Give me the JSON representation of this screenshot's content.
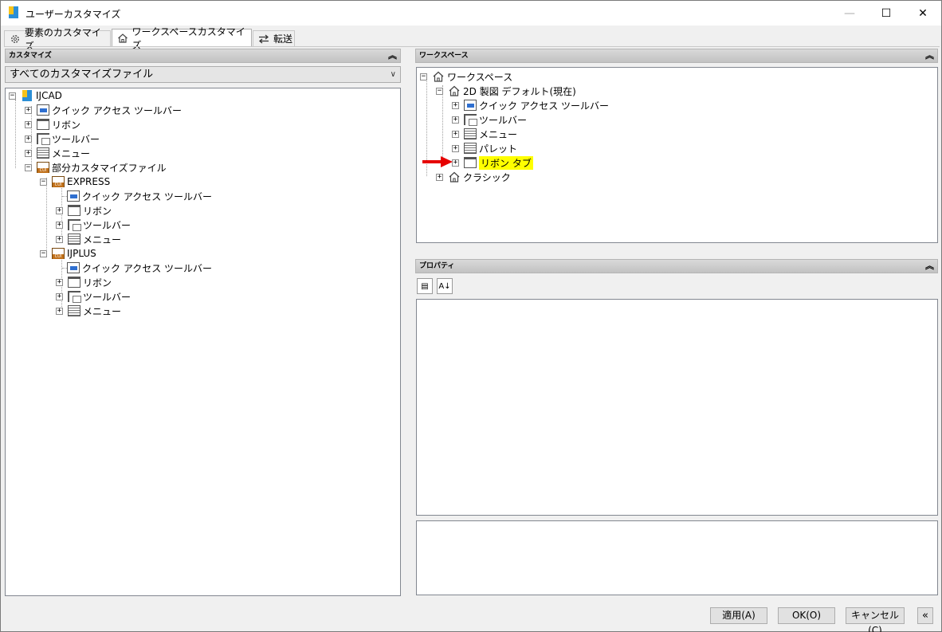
{
  "window": {
    "title": "ユーザーカスタマイズ",
    "controls": {
      "minimize": "—",
      "maximize": "☐",
      "close": "✕"
    }
  },
  "tabs": [
    {
      "label": "要素のカスタマイズ",
      "icon": "gear-icon",
      "active": false
    },
    {
      "label": "ワークスペースカスタマイズ",
      "icon": "home-icon",
      "active": true
    },
    {
      "label": "転送",
      "icon": "transfer-icon",
      "active": false
    }
  ],
  "left_panel": {
    "header": "カスタマイズ",
    "file_filter": "すべてのカスタマイズファイル",
    "tree": [
      {
        "label": "IJCAD",
        "icon": "ijcad-icon",
        "expander": "−"
      },
      {
        "label": "クイック アクセス ツールバー",
        "icon": "quick-access-toolbar-icon",
        "expander": "+"
      },
      {
        "label": "リボン",
        "icon": "ribbon-icon",
        "expander": "+"
      },
      {
        "label": "ツールバー",
        "icon": "toolbar-icon",
        "expander": "+"
      },
      {
        "label": "メニュー",
        "icon": "menu-icon",
        "expander": "+"
      },
      {
        "label": "部分カスタマイズファイル",
        "icon": "cui-file-icon",
        "expander": "−"
      },
      {
        "label": "EXPRESS",
        "icon": "cui-file-icon",
        "expander": "−"
      },
      {
        "label": "クイック アクセス ツールバー",
        "icon": "quick-access-toolbar-icon",
        "expander": ""
      },
      {
        "label": "リボン",
        "icon": "ribbon-icon",
        "expander": "+"
      },
      {
        "label": "ツールバー",
        "icon": "toolbar-icon",
        "expander": "+"
      },
      {
        "label": "メニュー",
        "icon": "menu-icon",
        "expander": "+"
      },
      {
        "label": "IJPLUS",
        "icon": "cui-file-icon",
        "expander": "−"
      },
      {
        "label": "クイック アクセス ツールバー",
        "icon": "quick-access-toolbar-icon",
        "expander": ""
      },
      {
        "label": "リボン",
        "icon": "ribbon-icon",
        "expander": "+"
      },
      {
        "label": "ツールバー",
        "icon": "toolbar-icon",
        "expander": "+"
      },
      {
        "label": "メニュー",
        "icon": "menu-icon",
        "expander": "+"
      }
    ]
  },
  "workspace_panel": {
    "header": "ワークスペース",
    "tree": [
      {
        "label": "ワークスペース",
        "icon": "home-icon",
        "expander": "−"
      },
      {
        "label": "2D 製図 デフォルト(現在)",
        "icon": "home-icon",
        "expander": "−"
      },
      {
        "label": "クイック アクセス ツールバー",
        "icon": "quick-access-toolbar-icon",
        "expander": "+"
      },
      {
        "label": "ツールバー",
        "icon": "toolbar-icon",
        "expander": "+"
      },
      {
        "label": "メニュー",
        "icon": "menu-icon",
        "expander": "+"
      },
      {
        "label": "パレット",
        "icon": "menu-icon",
        "expander": "+"
      },
      {
        "label": "リボン タブ",
        "icon": "ribbon-icon",
        "expander": "+",
        "highlighted": true
      },
      {
        "label": "クラシック",
        "icon": "home-icon",
        "expander": "+"
      }
    ],
    "annotation": "red-arrow-icon"
  },
  "properties_panel": {
    "header": "プロパティ",
    "toolbar": [
      {
        "icon": "categorized-icon",
        "glyph": "▤"
      },
      {
        "icon": "sort-az-icon",
        "glyph": "A↓"
      }
    ]
  },
  "footer": {
    "apply": "適用(A)",
    "ok": "OK(O)",
    "cancel": "キャンセル(C)",
    "collapse": "«"
  },
  "colors": {
    "highlight": "#ffff00",
    "annotation_arrow": "#e60000",
    "header_bg": "#c8c8c8"
  }
}
